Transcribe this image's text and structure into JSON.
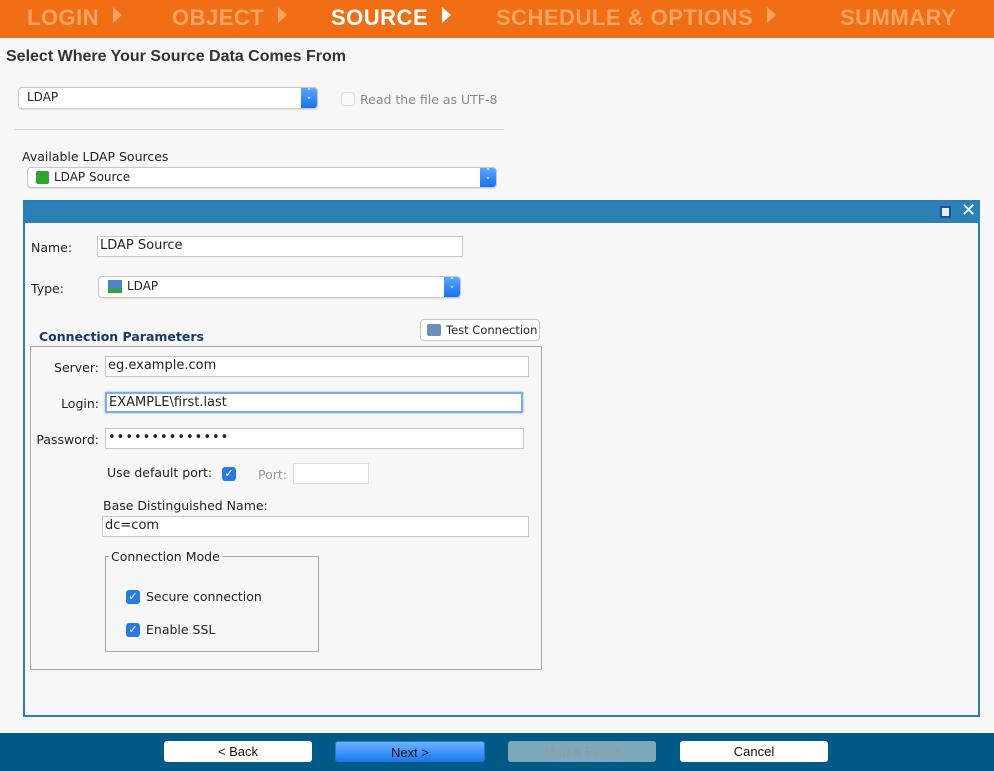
{
  "steps": [
    {
      "label": "LOGIN"
    },
    {
      "label": "OBJECT"
    },
    {
      "label": "SOURCE"
    },
    {
      "label": "SCHEDULE & OPTIONS"
    },
    {
      "label": "SUMMARY"
    }
  ],
  "active_step": "SOURCE",
  "page_title": "Select Where Your Source Data Comes From",
  "source_type": {
    "value": "LDAP"
  },
  "utf8": {
    "label": "Read the file as UTF-8",
    "checked": false
  },
  "available": {
    "label": "Available LDAP Sources",
    "value": "LDAP Source"
  },
  "panel": {
    "name_label": "Name:",
    "name_value": "LDAP Source",
    "type_label": "Type:",
    "type_value": "LDAP",
    "conn_params_title": "Connection Parameters",
    "test_connection": "Test Connection",
    "server_label": "Server:",
    "server_value": "eg.example.com",
    "login_label": "Login:",
    "login_value": "EXAMPLE\\first.last",
    "password_label": "Password:",
    "password_value": "••••••••••••••",
    "default_port_label": "Use default port:",
    "default_port_checked": true,
    "port_label": "Port:",
    "port_value": "",
    "base_dn_label": "Base Distinguished Name:",
    "base_dn_value": "dc=com",
    "mode_legend": "Connection Mode",
    "secure_label": "Secure connection",
    "secure_checked": true,
    "ssl_label": "Enable SSL",
    "ssl_checked": true
  },
  "footer": {
    "back": "< Back",
    "next": "Next >",
    "map_finish": "Map & Finish",
    "cancel": "Cancel"
  },
  "colors": {
    "header": "#f26e14",
    "panel": "#2b80b6",
    "footer": "#005a85"
  }
}
